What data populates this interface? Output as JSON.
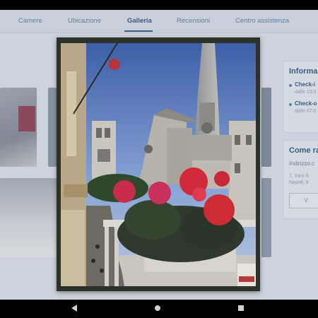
{
  "tabs": [
    {
      "label": "Camere"
    },
    {
      "label": "Ubicazione"
    },
    {
      "label": "Galleria"
    },
    {
      "label": "Recensioni"
    },
    {
      "label": "Centro assistenza"
    }
  ],
  "info": {
    "title": "Informa",
    "checkin_label": "Check-i",
    "checkin_time": "dalle 13:0",
    "checkout_label": "Check-o",
    "checkout_time": "dalle 07:0"
  },
  "route": {
    "title": "Come ra",
    "address_label": "Indirizzo c",
    "address_line1": "7, Vico S",
    "address_line2": "Napoli, It",
    "button_label": "V"
  },
  "colors": {
    "accent": "#3d5a80",
    "overlay": "#cdd3dc",
    "frame": "#2c3129"
  }
}
